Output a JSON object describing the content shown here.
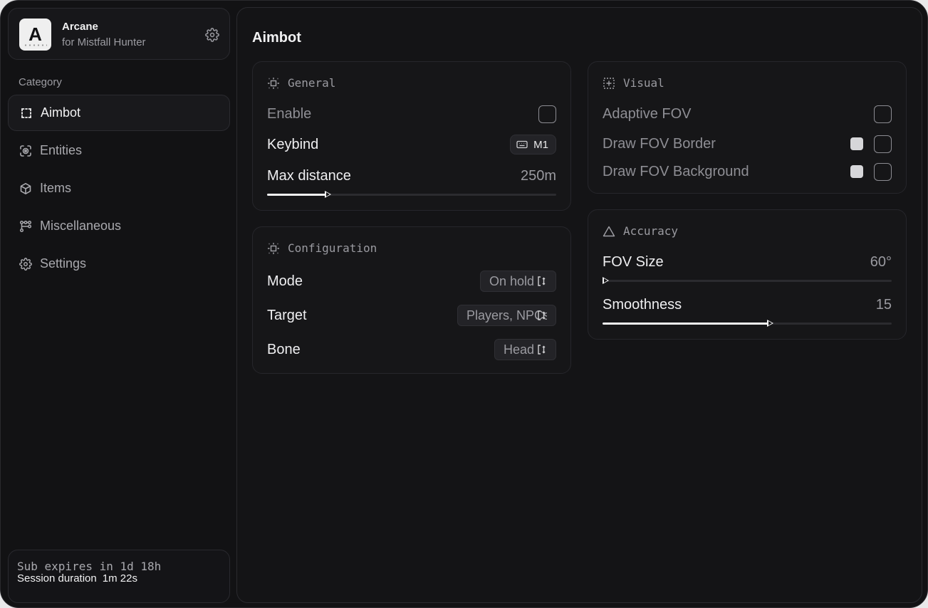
{
  "app": {
    "name": "Arcane",
    "subtitle": "for Mistfall Hunter",
    "logo_letter": "A"
  },
  "sidebar": {
    "category_label": "Category",
    "items": [
      {
        "label": "Aimbot",
        "icon": "dashed-square-icon",
        "active": true
      },
      {
        "label": "Entities",
        "icon": "scan-person-icon",
        "active": false
      },
      {
        "label": "Items",
        "icon": "box-icon",
        "active": false
      },
      {
        "label": "Miscellaneous",
        "icon": "nodes-icon",
        "active": false
      },
      {
        "label": "Settings",
        "icon": "gear-icon",
        "active": false
      }
    ],
    "footer": {
      "sub_expires": "Sub expires in 1d 18h",
      "session_label": "Session duration",
      "session_value": "1m 22s"
    }
  },
  "page": {
    "title": "Aimbot"
  },
  "general": {
    "title": "General",
    "enable_label": "Enable",
    "enable_checked": false,
    "keybind_label": "Keybind",
    "keybind_value": "M1",
    "max_distance_label": "Max distance",
    "max_distance_value": "250m",
    "max_distance_fraction": 0.21
  },
  "configuration": {
    "title": "Configuration",
    "mode_label": "Mode",
    "mode_value": "On hold",
    "target_label": "Target",
    "target_value": "Players, NPCs",
    "bone_label": "Bone",
    "bone_value": "Head"
  },
  "visual": {
    "title": "Visual",
    "adaptive_fov_label": "Adaptive FOV",
    "draw_fov_border_label": "Draw FOV Border",
    "draw_fov_background_label": "Draw FOV Background",
    "swatch_color": "#d6d6d9"
  },
  "accuracy": {
    "title": "Accuracy",
    "fov_size_label": "FOV Size",
    "fov_size_value": "60°",
    "fov_size_fraction": 0.0,
    "smoothness_label": "Smoothness",
    "smoothness_value": "15",
    "smoothness_fraction": 0.58
  }
}
